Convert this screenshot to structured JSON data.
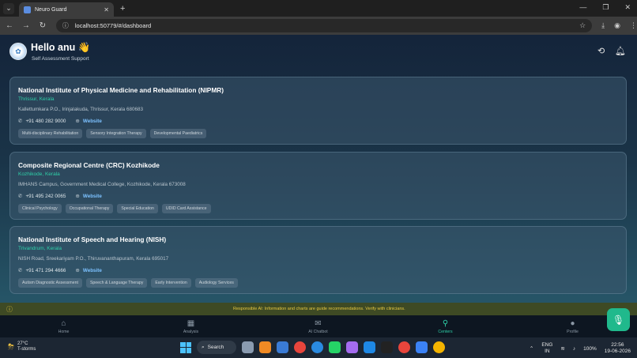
{
  "browser": {
    "tab_title": "Neuro Guard",
    "url": "localhost:50779/#/dashboard",
    "new_tab": "+",
    "minimize": "—",
    "restore": "❐",
    "close": "✕"
  },
  "header": {
    "greeting": "Hello anu 👋",
    "subtitle": "Self Assessment Support",
    "history_icon": "history-icon",
    "bell_icon": "bell-icon"
  },
  "centers": [
    {
      "name": "National Institute of Physical Medicine and Rehabilitation (NIPMR)",
      "location": "Thrissur, Kerala",
      "address": "Kallettumkara P.O., Irinjalakuda, Thrissur, Kerala 680683",
      "phone": "+91 480 282 9000",
      "website": "Website",
      "tags": [
        "Multi-disciplinary Rehabilitation",
        "Sensory Integration Therapy",
        "Developmental Paediatrics"
      ]
    },
    {
      "name": "Composite Regional Centre (CRC) Kozhikode",
      "location": "Kozhikode, Kerala",
      "address": "IMHANS Campus, Government Medical College, Kozhikode, Kerala 673008",
      "phone": "+91 495 242 0065",
      "website": "Website",
      "tags": [
        "Clinical Psychology",
        "Occupational Therapy",
        "Special Education",
        "UDID Card Assistance"
      ]
    },
    {
      "name": "National Institute of Speech and Hearing (NISH)",
      "location": "Trivandrum, Kerala",
      "address": "NISH Road, Sreekariyam P.O., Thiruvananthapuram, Kerala 695017",
      "phone": "+91 471 294 4666",
      "website": "Website",
      "tags": [
        "Autism Diagnostic Assessment",
        "Speech & Language Therapy",
        "Early Intervention",
        "Audiology Services"
      ]
    }
  ],
  "banner": {
    "text": "Responsible AI: Information and charts are guide recommendations. Verify with clinicians."
  },
  "bottom_nav": [
    {
      "label": "Home",
      "icon": "home-icon",
      "glyph": "⌂"
    },
    {
      "label": "Analysis",
      "icon": "analysis-icon",
      "glyph": "▦"
    },
    {
      "label": "AI Chatbot",
      "icon": "chat-icon",
      "glyph": "✉"
    },
    {
      "label": "Centers",
      "icon": "location-pin-icon",
      "glyph": "⚲"
    },
    {
      "label": "Profile",
      "icon": "profile-icon",
      "glyph": "●"
    }
  ],
  "active_nav": "Centers",
  "taskbar": {
    "temp": "27°C",
    "condition": "T-storms",
    "search": "Search",
    "lang1": "ENG",
    "lang2": "IN",
    "battery": "100%",
    "time": "22:56",
    "date": "19-06-2026"
  },
  "colors": {
    "accent": "#2ecfa8",
    "link": "#7cc1ff",
    "banner_text": "#e7c840",
    "fab": "#20b98c"
  }
}
